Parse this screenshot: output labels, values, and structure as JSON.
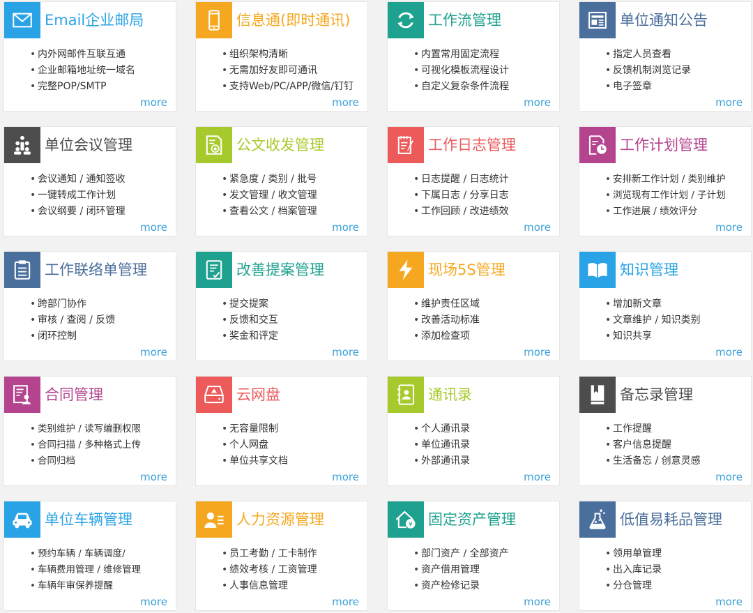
{
  "more_label": "more",
  "cards": [
    {
      "title": "Email企业邮局",
      "icon": "envelope-icon",
      "color": "#2aa3e6",
      "items": [
        "内外网邮件互联互通",
        "企业邮箱地址统一域名",
        "完整POP/SMTP"
      ]
    },
    {
      "title": "信息通(即时通讯)",
      "icon": "mobile-phone-icon",
      "color": "#f5a81f",
      "items": [
        "组织架构清晰",
        "无需加好友即可通讯",
        "支持Web/PC/APP/微信/钉钉"
      ]
    },
    {
      "title": "工作流管理",
      "icon": "refresh-cycle-icon",
      "color": "#1ea18e",
      "items": [
        "内置常用固定流程",
        "可视化模板流程设计",
        "自定义复杂条件流程"
      ]
    },
    {
      "title": "单位通知公告",
      "icon": "newspaper-icon",
      "color": "#4b6f9d",
      "items": [
        "指定人员查看",
        "反馈机制浏览记录",
        "电子签章"
      ]
    },
    {
      "title": "单位会议管理",
      "icon": "meeting-people-icon",
      "color": "#4d4d4d",
      "items": [
        "会议通知 / 通知签收",
        "一键转成工作计划",
        "会议纲要 / 闭环管理"
      ]
    },
    {
      "title": "公文收发管理",
      "icon": "document-seal-icon",
      "color": "#a6ca2b",
      "items": [
        "紧急度 / 类别 / 批号",
        "发文管理 / 收文管理",
        "查看公文 / 档案管理"
      ]
    },
    {
      "title": "工作日志管理",
      "icon": "notepad-pen-icon",
      "color": "#ec5a5a",
      "items": [
        "日志提醒 / 日志统计",
        "下属日志 / 分享日志",
        "工作回顾 / 改进绩效"
      ]
    },
    {
      "title": "工作计划管理",
      "icon": "calendar-clock-icon",
      "color": "#b4448e",
      "items": [
        "安排新工作计划 / 类别维护",
        "浏览现有工作计划 / 子计划",
        "工作进展 / 绩效评分"
      ]
    },
    {
      "title": "工作联络单管理",
      "icon": "clipboard-icon",
      "color": "#4b6f9d",
      "items": [
        "跨部门协作",
        "审核 / 查阅 / 反馈",
        "闭环控制"
      ]
    },
    {
      "title": "改善提案管理",
      "icon": "checklist-icon",
      "color": "#1ea18e",
      "items": [
        "提交提案",
        "反馈和交互",
        "奖金和评定"
      ]
    },
    {
      "title": "现场5S管理",
      "icon": "lightning-icon",
      "color": "#f5a81f",
      "items": [
        "维护责任区域",
        "改善活动标准",
        "添加检查项"
      ]
    },
    {
      "title": "知识管理",
      "icon": "open-book-icon",
      "color": "#2aa3e6",
      "items": [
        "增加新文章",
        "文章维护 / 知识类别",
        "知识共享"
      ]
    },
    {
      "title": "合同管理",
      "icon": "contract-person-icon",
      "color": "#b4448e",
      "items": [
        "类别维护 / 读写编删权限",
        "合同扫描 / 多种格式上传",
        "合同归档"
      ]
    },
    {
      "title": "云网盘",
      "icon": "cloud-drive-icon",
      "color": "#ec5a5a",
      "items": [
        "无容量限制",
        "个人网盘",
        "单位共享文档"
      ]
    },
    {
      "title": "通讯录",
      "icon": "address-book-icon",
      "color": "#a6ca2b",
      "items": [
        "个人通讯录",
        "单位通讯录",
        "外部通讯录"
      ]
    },
    {
      "title": "备忘录管理",
      "icon": "bookmark-book-icon",
      "color": "#4d4d4d",
      "items": [
        "工作提醒",
        "客户信息提醒",
        "生活备忘 / 创意灵感"
      ]
    },
    {
      "title": "单位车辆管理",
      "icon": "car-icon",
      "color": "#2aa3e6",
      "items": [
        "预约车辆 / 车辆调度/",
        "车辆费用管理 / 维修管理",
        "车辆年审保养提醒"
      ]
    },
    {
      "title": "人力资源管理",
      "icon": "person-card-icon",
      "color": "#f5a81f",
      "items": [
        "员工考勤 / 工卡制作",
        "绩效考核 / 工资管理",
        "人事信息管理"
      ]
    },
    {
      "title": "固定资产管理",
      "icon": "house-yen-icon",
      "color": "#1ea18e",
      "items": [
        "部门资产 / 全部资产",
        "资产借用管理",
        "资产检修记录"
      ]
    },
    {
      "title": "低值易耗品管理",
      "icon": "flask-icon",
      "color": "#4b6f9d",
      "items": [
        "领用单管理",
        "出入库记录",
        "分仓管理"
      ]
    }
  ]
}
